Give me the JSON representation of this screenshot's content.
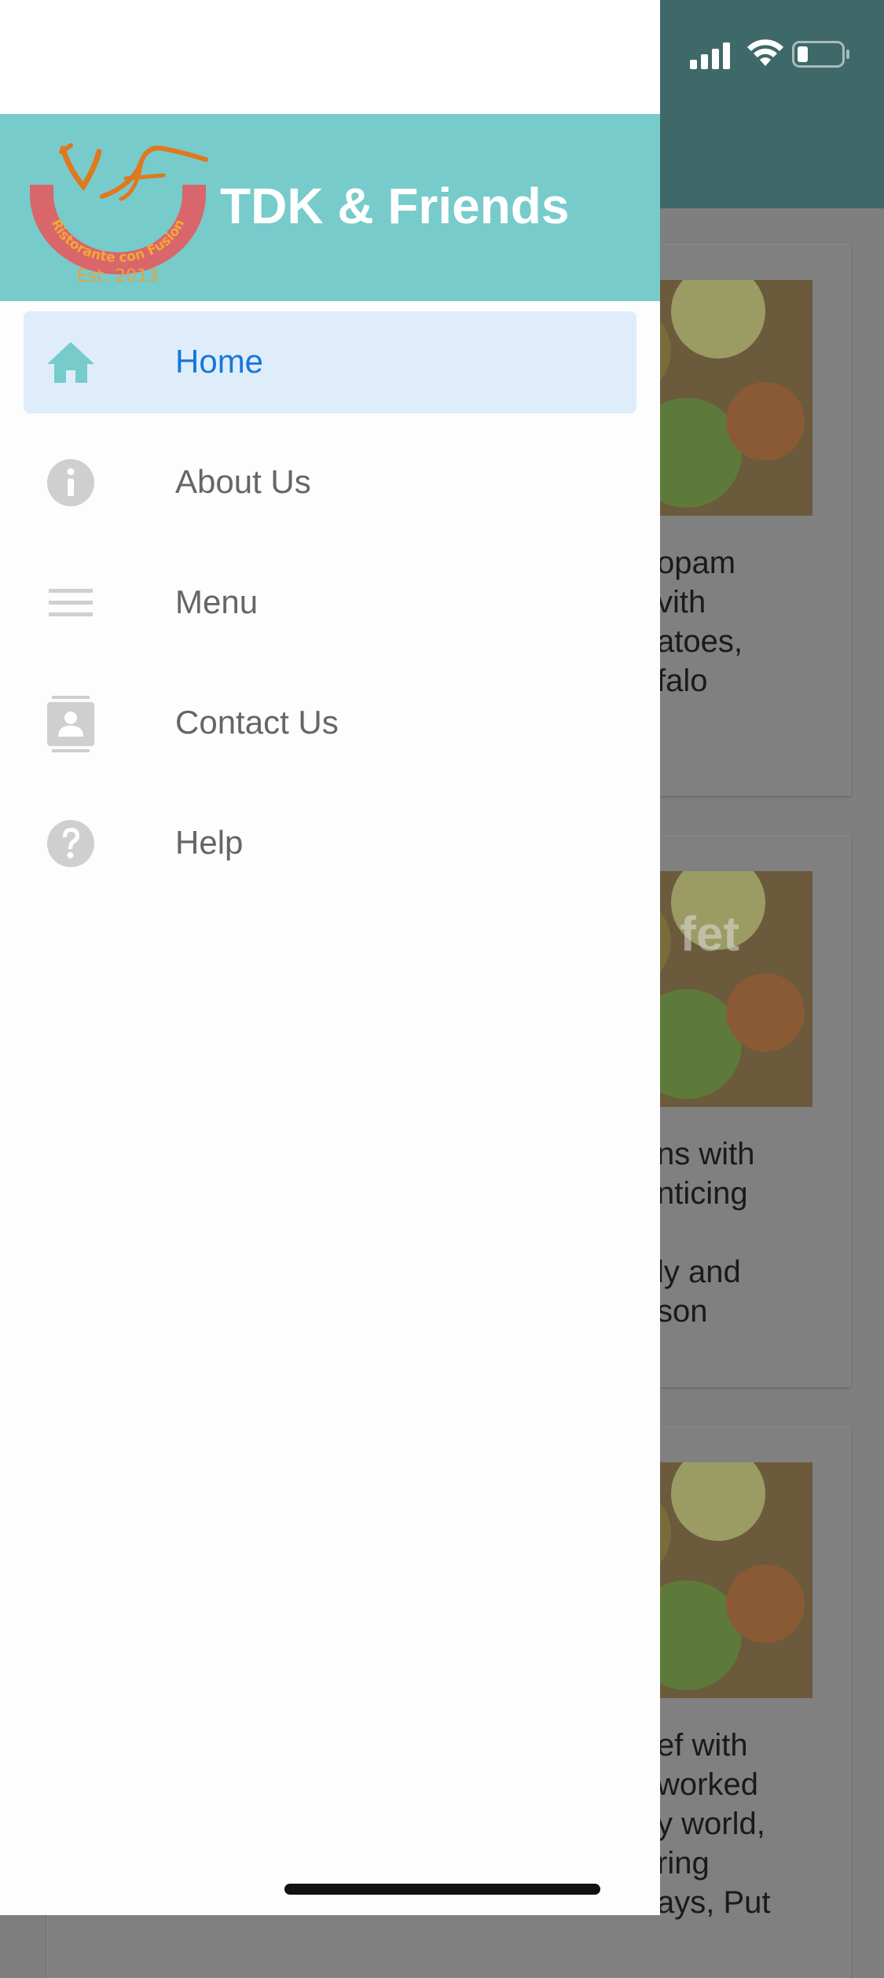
{
  "colors": {
    "drawer_header": "#77cbcb",
    "active_item_bg": "#dfedfb",
    "active_item_text": "#1877d8",
    "inactive_text": "#666666",
    "icon_gray": "#cfcfcf",
    "app_bar": "#3e6968"
  },
  "drawer": {
    "logo": {
      "arc_text": "Ristorante con Fusion",
      "est_text": "Est. 2013"
    },
    "title": "TDK & Friends",
    "items": [
      {
        "label": "Home",
        "icon": "home-icon",
        "active": true
      },
      {
        "label": "About Us",
        "icon": "info-icon",
        "active": false
      },
      {
        "label": "Menu",
        "icon": "menu-lines-icon",
        "active": false
      },
      {
        "label": "Contact Us",
        "icon": "contact-card-icon",
        "active": false
      },
      {
        "label": "Help",
        "icon": "help-icon",
        "active": false
      }
    ]
  },
  "background": {
    "cards": [
      {
        "overlay": "",
        "lines": [
          "opam",
          "vith",
          "atoes,",
          "falo"
        ]
      },
      {
        "overlay": "fet",
        "lines": [
          "ns with",
          "nticing",
          "",
          "ly and",
          "son"
        ]
      },
      {
        "overlay": "",
        "lines": [
          "ef with",
          "worked",
          "y world,",
          "ring",
          "ays, Put"
        ]
      }
    ]
  }
}
